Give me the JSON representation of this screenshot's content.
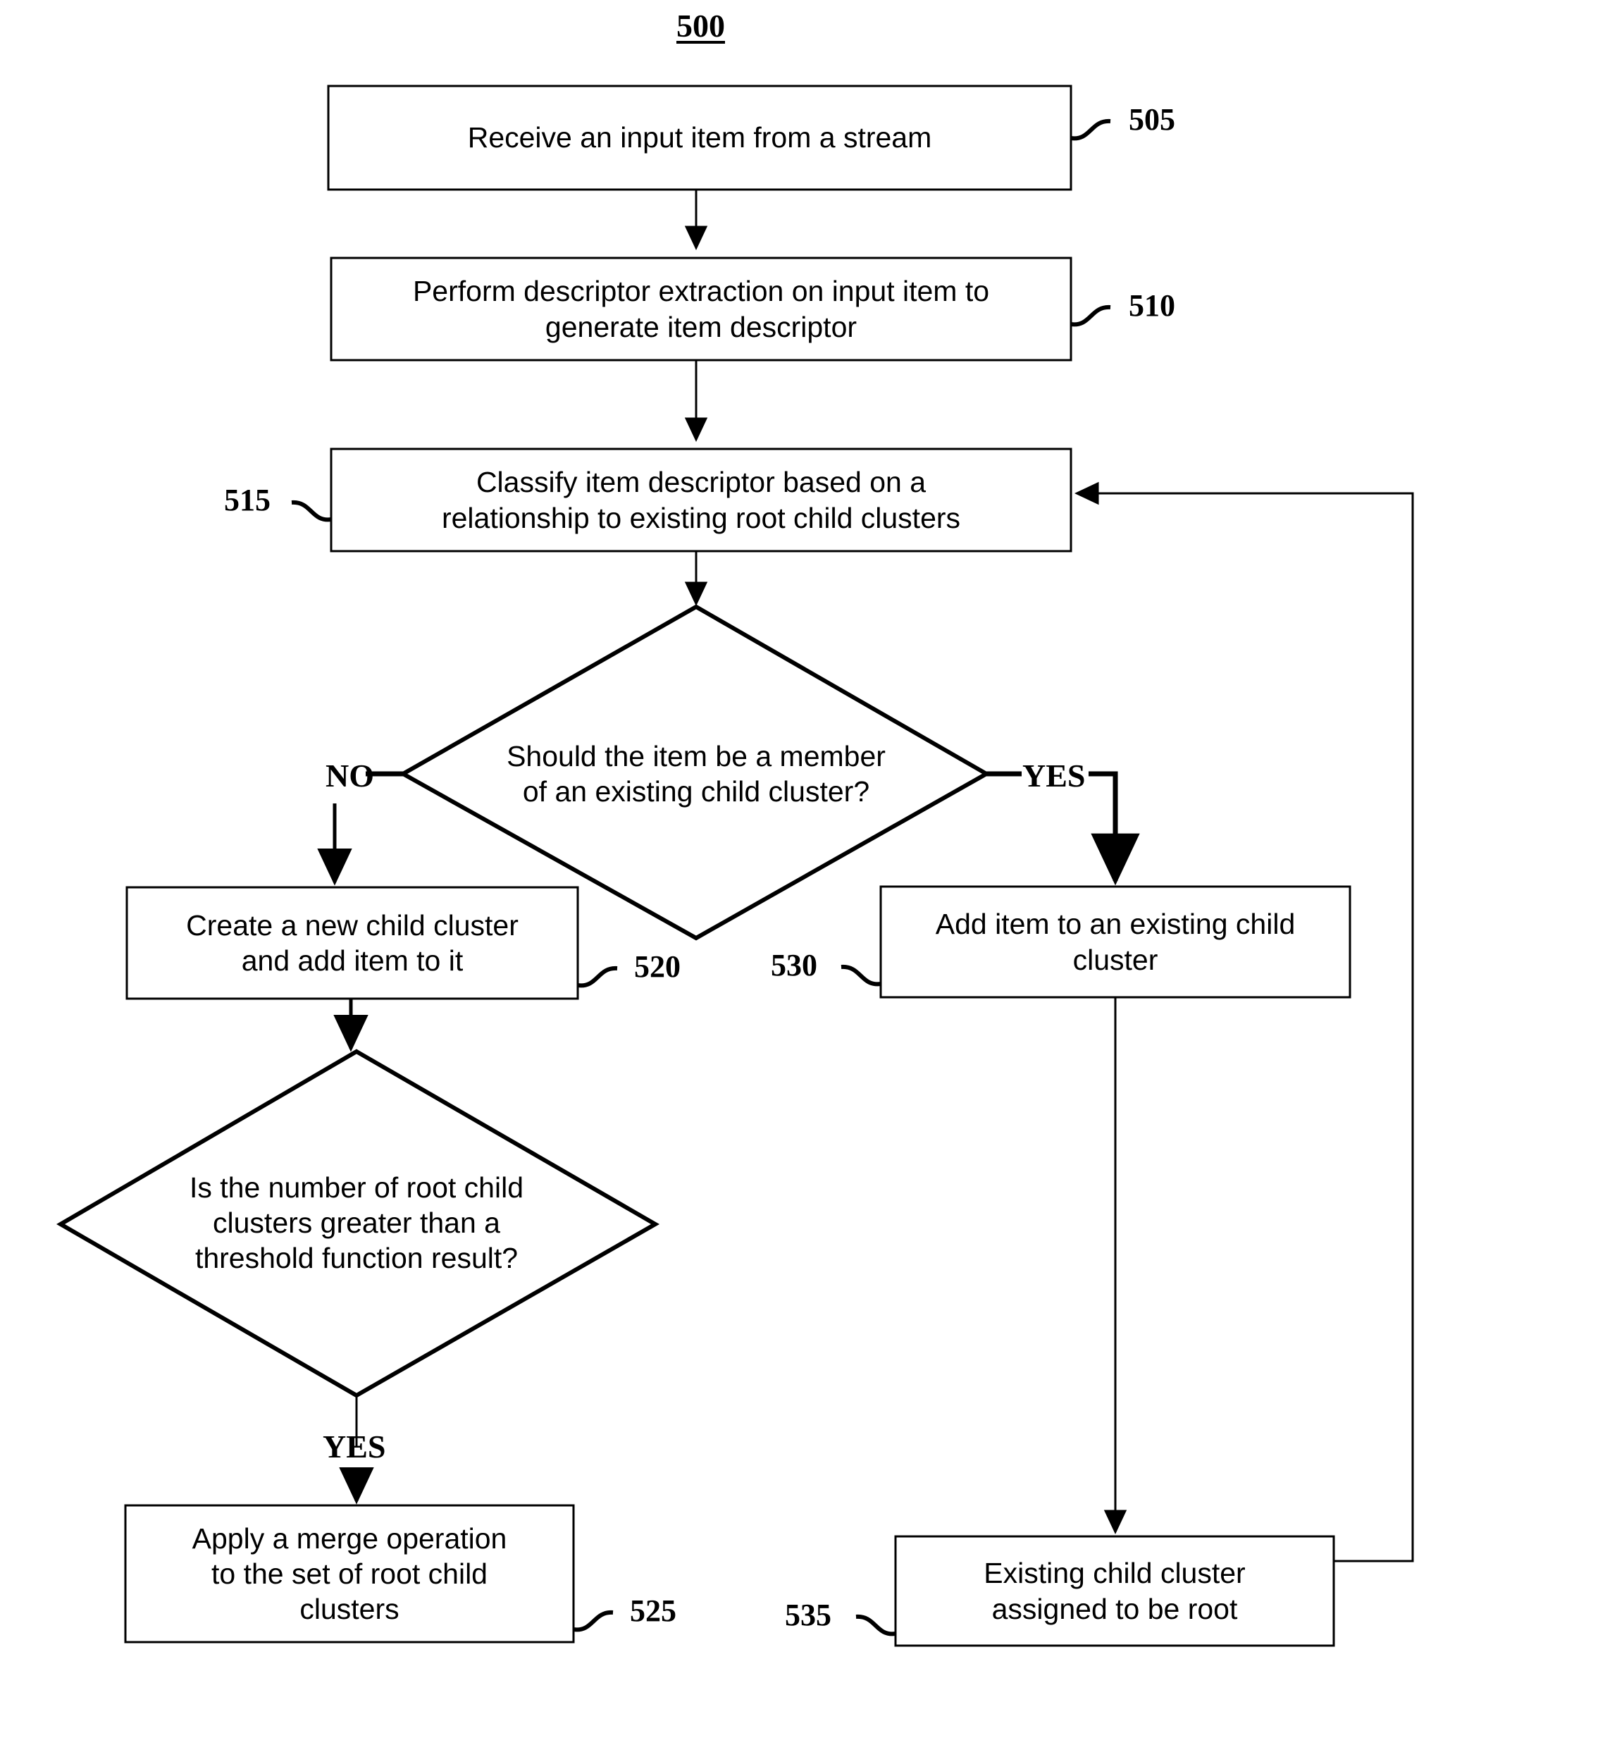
{
  "figure": {
    "number": "500"
  },
  "nodes": [
    {
      "id": "505",
      "ref": "505",
      "shape": "process",
      "text": "Receive an input item from a stream"
    },
    {
      "id": "510",
      "ref": "510",
      "shape": "process",
      "text": "Perform descriptor extraction on input item to\ngenerate item descriptor"
    },
    {
      "id": "515",
      "ref": "515",
      "shape": "process",
      "text": "Classify item descriptor based on a\nrelationship to existing root child clusters"
    },
    {
      "id": "decision1",
      "ref": "",
      "shape": "decision",
      "text": "Should the item be a member\nof an existing child cluster?"
    },
    {
      "id": "520",
      "ref": "520",
      "shape": "process",
      "text": "Create a new child cluster\nand add item to it"
    },
    {
      "id": "530",
      "ref": "530",
      "shape": "process",
      "text": "Add item to an existing child\ncluster"
    },
    {
      "id": "decision2",
      "ref": "",
      "shape": "decision",
      "text": "Is the number of root child\nclusters greater than a\nthreshold function result?"
    },
    {
      "id": "525",
      "ref": "525",
      "shape": "process",
      "text": "Apply a merge operation\nto the set of root child\nclusters"
    },
    {
      "id": "535",
      "ref": "535",
      "shape": "process",
      "text": "Existing child cluster\nassigned to be root"
    }
  ],
  "branch_labels": {
    "decision1_no": "NO",
    "decision1_yes": "YES",
    "decision2_yes": "YES"
  },
  "colors": {
    "stroke": "#000000",
    "fill": "#ffffff",
    "text": "#000000"
  }
}
